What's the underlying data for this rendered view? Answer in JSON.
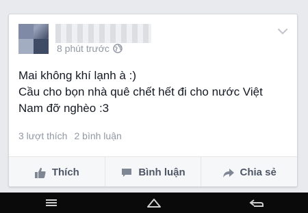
{
  "post": {
    "author_name": "",
    "time": "8 phút trước",
    "privacy_icon": "globe-icon",
    "text_lines": [
      "Mai không khí lạnh à :)",
      "Cầu cho bọn nhà quê chết hết đi cho nước Việt",
      "Nam đỡ nghèo :3"
    ],
    "likes": "3 lượt thích",
    "comments": "2 bình luận"
  },
  "actions": {
    "like": "Thích",
    "comment": "Bình luận",
    "share": "Chia sẻ"
  },
  "system_nav": {
    "icons": [
      "menu-icon",
      "home-icon",
      "back-icon"
    ]
  },
  "colors": {
    "text": "#141823",
    "muted": "#9197a3",
    "action_text": "#4e5665",
    "background": "#e9eaed"
  }
}
